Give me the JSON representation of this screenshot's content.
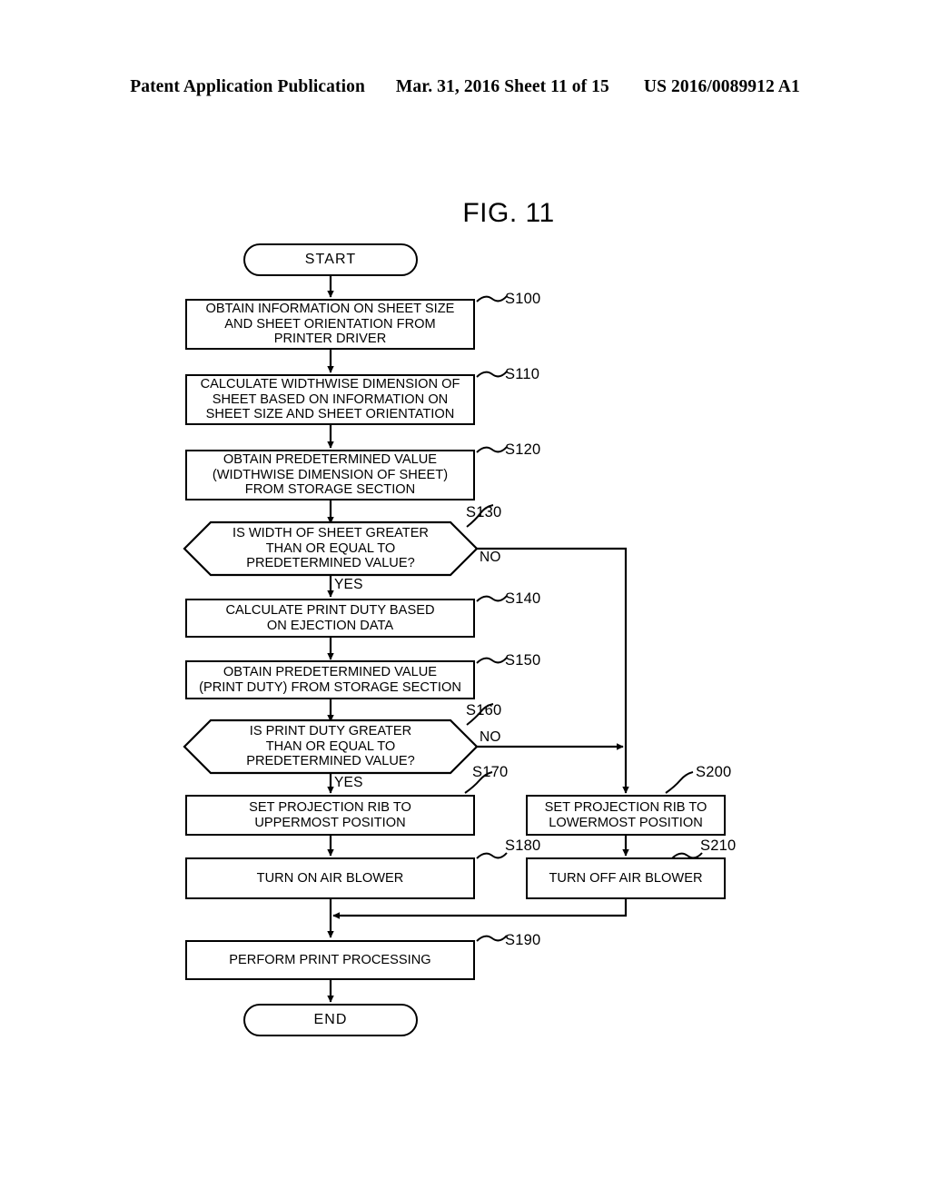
{
  "header": {
    "left": "Patent Application Publication",
    "middle": "Mar. 31, 2016  Sheet 11 of 15",
    "right": "US 2016/0089912 A1"
  },
  "figure": {
    "title": "FIG. 11"
  },
  "flowchart": {
    "start": {
      "label": "START"
    },
    "end": {
      "label": "END"
    },
    "steps": [
      {
        "ref": "S100",
        "text": "OBTAIN INFORMATION ON SHEET SIZE\nAND SHEET ORIENTATION FROM\nPRINTER DRIVER",
        "type": "process"
      },
      {
        "ref": "S110",
        "text": "CALCULATE WIDTHWISE DIMENSION OF\nSHEET BASED ON INFORMATION ON\nSHEET SIZE AND SHEET ORIENTATION",
        "type": "process"
      },
      {
        "ref": "S120",
        "text": "OBTAIN PREDETERMINED VALUE\n(WIDTHWISE DIMENSION OF SHEET)\nFROM STORAGE SECTION",
        "type": "process"
      },
      {
        "ref": "S130",
        "text": "IS WIDTH OF SHEET GREATER\nTHAN OR EQUAL TO\nPREDETERMINED VALUE?",
        "type": "decision",
        "yes_label": "YES",
        "no_label": "NO"
      },
      {
        "ref": "S140",
        "text": "CALCULATE PRINT DUTY BASED\nON EJECTION DATA",
        "type": "process"
      },
      {
        "ref": "S150",
        "text": "OBTAIN PREDETERMINED VALUE\n(PRINT DUTY) FROM STORAGE SECTION",
        "type": "process"
      },
      {
        "ref": "S160",
        "text": "IS PRINT DUTY GREATER\nTHAN OR EQUAL TO\nPREDETERMINED VALUE?",
        "type": "decision",
        "yes_label": "YES",
        "no_label": "NO"
      },
      {
        "ref": "S170",
        "text": "SET PROJECTION RIB TO\nUPPERMOST POSITION",
        "type": "process"
      },
      {
        "ref": "S180",
        "text": "TURN ON AIR BLOWER",
        "type": "process"
      },
      {
        "ref": "S190",
        "text": "PERFORM PRINT PROCESSING",
        "type": "process"
      },
      {
        "ref": "S200",
        "text": "SET PROJECTION RIB TO\nLOWERMOST POSITION",
        "type": "process"
      },
      {
        "ref": "S210",
        "text": "TURN OFF AIR BLOWER",
        "type": "process"
      }
    ]
  },
  "colors": {
    "ink": "#000000",
    "paper": "#ffffff"
  }
}
